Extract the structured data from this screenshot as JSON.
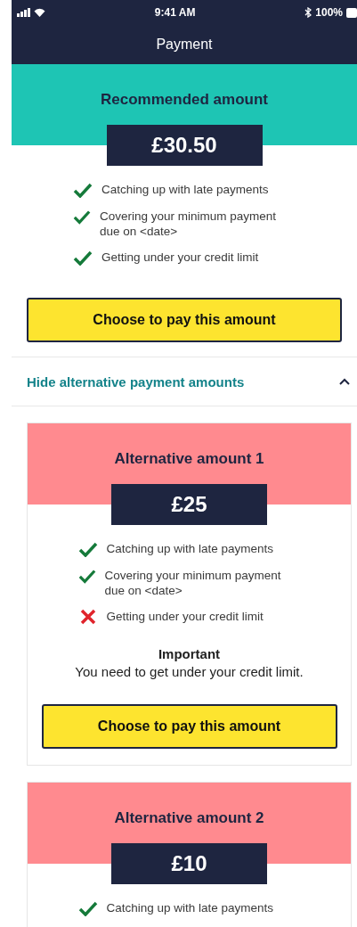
{
  "status_bar": {
    "time": "9:41 AM",
    "battery": "100%"
  },
  "nav": {
    "title": "Payment"
  },
  "recommended": {
    "kind": "recommended",
    "title": "Recommended amount",
    "amount": "£30.50",
    "items": [
      {
        "text": "Catching up with late payments",
        "met": true
      },
      {
        "text": "Covering your minimum payment due on <date>",
        "met": true
      },
      {
        "text": "Getting under your credit limit",
        "met": true
      }
    ],
    "button": "Choose to pay this amount"
  },
  "toggle": {
    "label": "Hide alternative payment amounts",
    "expanded": true
  },
  "alternatives": [
    {
      "kind": "alternative",
      "title": "Alternative amount 1",
      "amount": "£25",
      "items": [
        {
          "text": "Catching up with late payments",
          "met": true
        },
        {
          "text": "Covering your minimum payment due on <date>",
          "met": true
        },
        {
          "text": "Getting under your credit limit",
          "met": false
        }
      ],
      "notice": {
        "title": "Important",
        "text": "You need to get under your credit limit."
      },
      "button": "Choose to pay this amount"
    },
    {
      "kind": "alternative",
      "title": "Alternative amount 2",
      "amount": "£10",
      "items": [
        {
          "text": "Catching up with late payments",
          "met": true
        }
      ]
    }
  ]
}
